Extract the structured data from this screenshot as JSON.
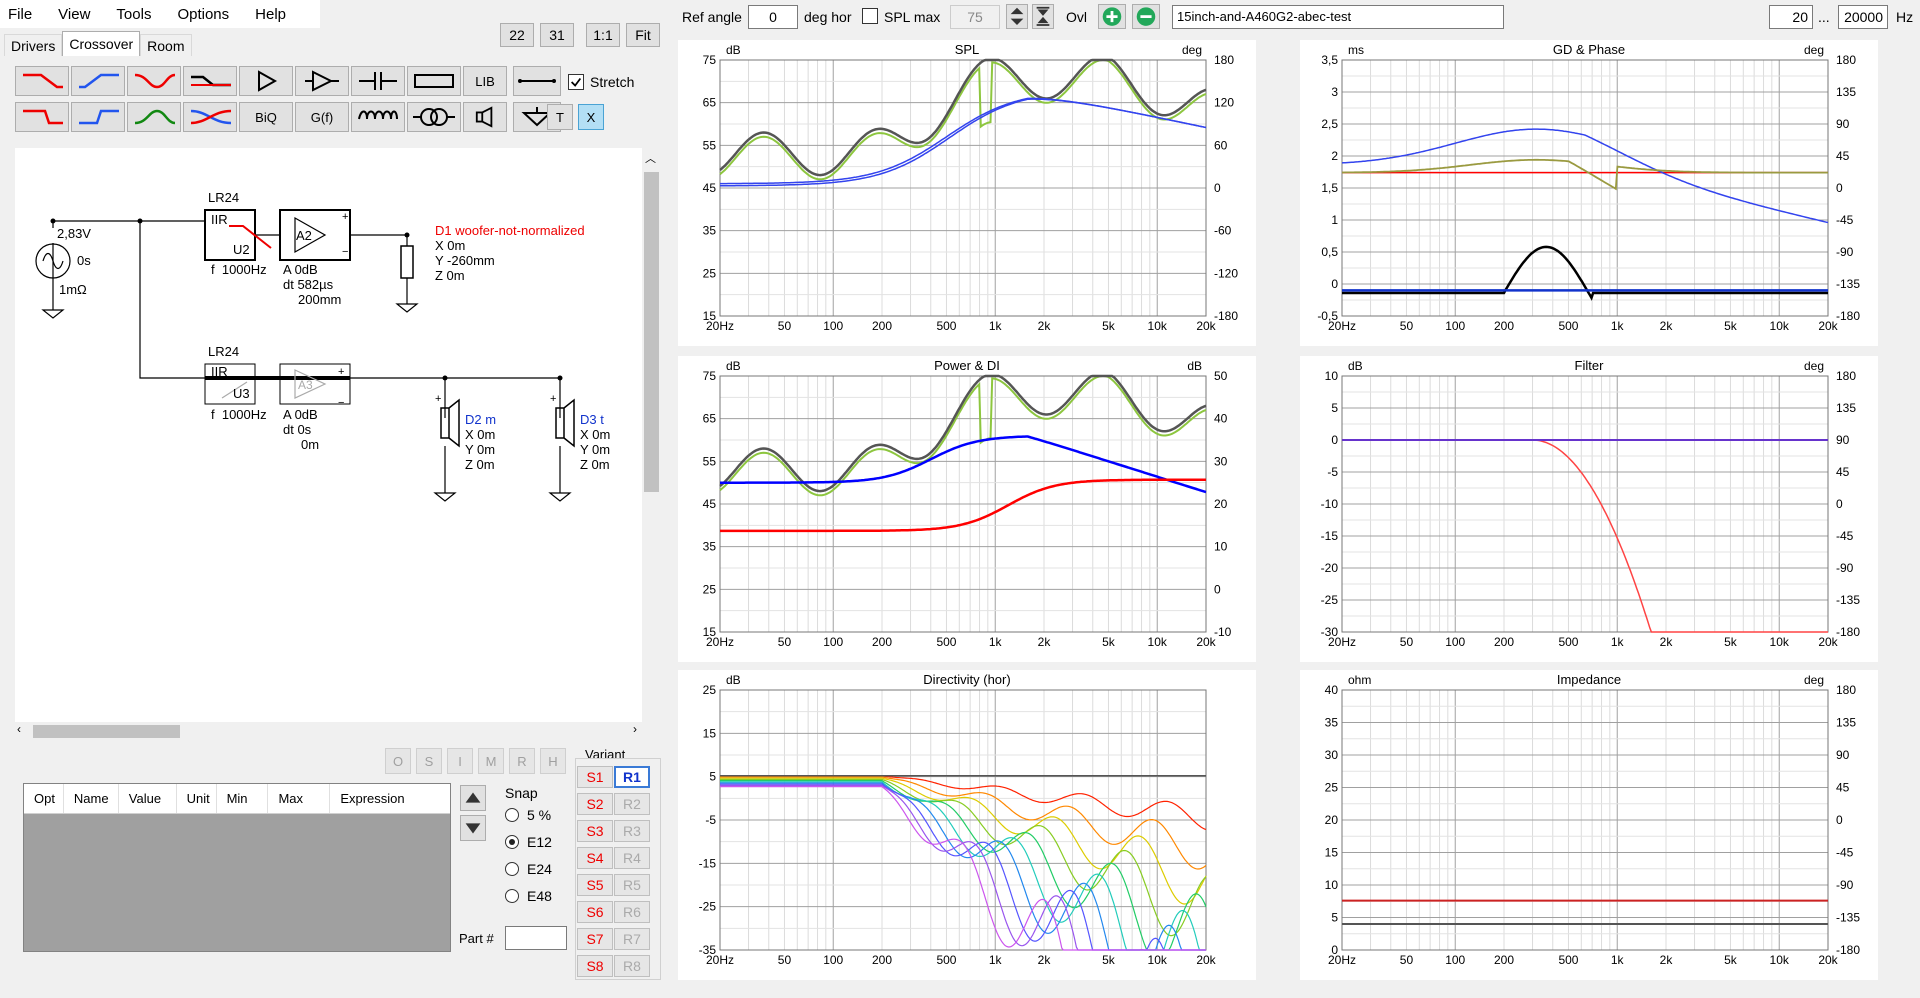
{
  "menu": [
    "File",
    "View",
    "Tools",
    "Options",
    "Help"
  ],
  "tabs": [
    "Drivers",
    "Crossover",
    "Room"
  ],
  "topButtons": {
    "b22": "22",
    "b31": "31",
    "b11": "1:1",
    "fit": "Fit"
  },
  "palette": {
    "biq": "BiQ",
    "gf": "G(f)",
    "lib": "LIB",
    "t": "T",
    "x": "X",
    "stretch": "Stretch"
  },
  "schematic": {
    "source": {
      "voltage": "2,83V",
      "delay": "0s",
      "resistance": "1mΩ"
    },
    "f1": {
      "type": "LR24",
      "block": "IIR",
      "unit": "U2",
      "freq": "f  1000Hz",
      "amp": "A2",
      "a": "A  0dB",
      "dt": "dt 582µs",
      "dist": "200mm"
    },
    "f2": {
      "type": "LR24",
      "block": "IIR",
      "unit": "U3",
      "freq": "f  1000Hz",
      "amp": "A3",
      "a": "A  0dB",
      "dt": "dt 0s",
      "dist": "0m"
    },
    "d1": {
      "name": "D1 woofer-not-normalized",
      "x": "X 0m",
      "y": "Y -260mm",
      "z": "Z 0m"
    },
    "d2": {
      "name": "D2 m",
      "x": "X 0m",
      "y": "Y 0m",
      "z": "Z 0m"
    },
    "d3": {
      "name": "D3 t",
      "x": "X 0m",
      "y": "Y 0m",
      "z": "Z 0m"
    }
  },
  "ops": [
    "O",
    "S",
    "I",
    "M",
    "R",
    "H"
  ],
  "table": {
    "headers": [
      "Opt",
      "Name",
      "Value",
      "Unit",
      "Min",
      "Max",
      "Expression"
    ]
  },
  "snap": {
    "label": "Snap",
    "options": [
      "5 %",
      "E12",
      "E24",
      "E48"
    ],
    "selected": "E12"
  },
  "partLabel": "Part #",
  "variant": {
    "label": "Variant",
    "s": [
      "S1",
      "S2",
      "S3",
      "S4",
      "S5",
      "S6",
      "S7",
      "S8"
    ],
    "r": [
      "R1",
      "R2",
      "R3",
      "R4",
      "R5",
      "R6",
      "R7",
      "R8"
    ]
  },
  "topbar": {
    "refAngleLabel": "Ref angle",
    "refAngle": "0",
    "degHor": "deg hor",
    "splMaxLabel": "SPL max",
    "splMax": "75",
    "ovl": "Ovl",
    "project": "15inch-and-A460G2-abec-test",
    "fmin": "20",
    "dots": "...",
    "fmax": "20000",
    "hz": "Hz"
  },
  "xticks": [
    "20Hz",
    "50",
    "100",
    "200",
    "500",
    "1k",
    "2k",
    "5k",
    "10k",
    "20k"
  ],
  "charts": [
    {
      "id": "spl",
      "title": "SPL",
      "yunit": "dB",
      "runit": "deg",
      "yticks": [
        "75",
        "65",
        "55",
        "45",
        "35",
        "25",
        "15"
      ],
      "rticks": [
        "180",
        "120",
        "60",
        "0",
        "-60",
        "-120",
        "-180"
      ]
    },
    {
      "id": "gd",
      "title": "GD & Phase",
      "yunit": "ms",
      "runit": "deg",
      "yticks": [
        "3,5",
        "3",
        "2,5",
        "2",
        "1,5",
        "1",
        "0,5",
        "0",
        "-0,5"
      ],
      "rticks": [
        "180",
        "135",
        "90",
        "45",
        "0",
        "-45",
        "-90",
        "-135",
        "-180"
      ]
    },
    {
      "id": "pow",
      "title": "Power & DI",
      "yunit": "dB",
      "runit": "dB",
      "yticks": [
        "75",
        "65",
        "55",
        "45",
        "35",
        "25",
        "15"
      ],
      "rticks": [
        "50",
        "40",
        "30",
        "20",
        "10",
        "0",
        "-10"
      ]
    },
    {
      "id": "filt",
      "title": "Filter",
      "yunit": "dB",
      "runit": "deg",
      "yticks": [
        "10",
        "5",
        "0",
        "-5",
        "-10",
        "-15",
        "-20",
        "-25",
        "-30"
      ],
      "rticks": [
        "180",
        "135",
        "90",
        "45",
        "0",
        "-45",
        "-90",
        "-135",
        "-180"
      ]
    },
    {
      "id": "dir",
      "title": "Directivity (hor)",
      "yunit": "dB",
      "runit": "",
      "yticks": [
        "25",
        "15",
        "5",
        "-5",
        "-15",
        "-25",
        "-35"
      ],
      "rticks": []
    },
    {
      "id": "imp",
      "title": "Impedance",
      "yunit": "ohm",
      "runit": "deg",
      "yticks": [
        "40",
        "35",
        "30",
        "25",
        "20",
        "15",
        "10",
        "5",
        "0"
      ],
      "rticks": [
        "180",
        "135",
        "90",
        "45",
        "0",
        "-45",
        "-90",
        "-135",
        "-180"
      ]
    }
  ],
  "colors": {
    "red": "#ff0000",
    "blue": "#0000ff",
    "green": "#8dc63f",
    "gray": "#555555",
    "olive": "#9a9a40"
  }
}
